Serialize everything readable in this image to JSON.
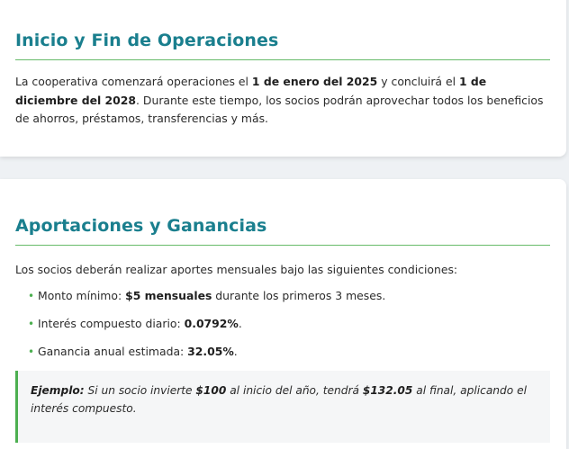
{
  "section1": {
    "title": "Inicio y Fin de Operaciones",
    "text_a": "La cooperativa comenzará operaciones el ",
    "start_date": "1 de enero del 2025",
    "text_b": " y concluirá el ",
    "end_date": "1 de diciembre del 2028",
    "text_c": ". Durante este tiempo, los socios podrán aprovechar todos los beneficios de ahorros, préstamos, transferencias y más."
  },
  "section2": {
    "title": "Aportaciones y Ganancias",
    "intro": "Los socios deberán realizar aportes mensuales bajo las siguientes condiciones:",
    "items": [
      {
        "bullet": "•",
        "label": "Monto mínimo: ",
        "value": "$5 mensuales",
        "suffix": " durante los primeros 3 meses."
      },
      {
        "bullet": "•",
        "label": "Interés compuesto diario: ",
        "value": "0.0792%",
        "suffix": "."
      },
      {
        "bullet": "•",
        "label": "Ganancia anual estimada: ",
        "value": "32.05%",
        "suffix": "."
      }
    ],
    "example": {
      "label": "Ejemplo:",
      "text_a": " Si un socio invierte ",
      "amount_in": "$100",
      "text_b": " al inicio del año, tendrá ",
      "amount_out": "$132.05",
      "text_c": " al final, aplicando el interés compuesto."
    }
  },
  "colors": {
    "heading": "#1a7f8e",
    "accent": "#4caf50",
    "background": "#eef1f4"
  }
}
